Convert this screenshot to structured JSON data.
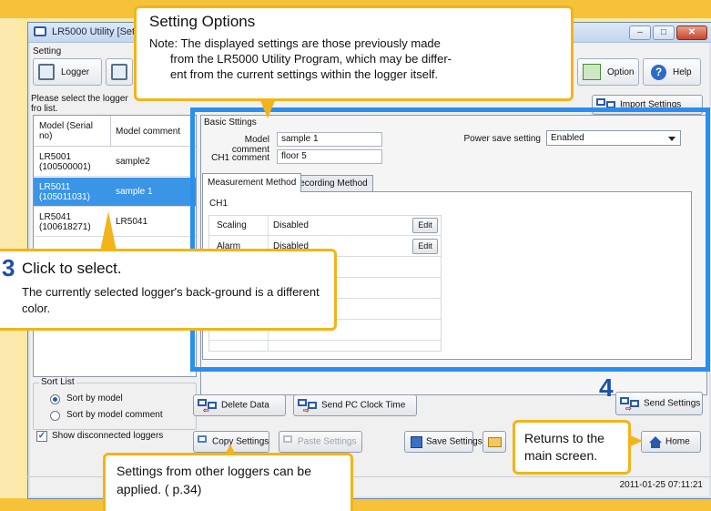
{
  "window": {
    "title": "LR5000 Utility [Setting"
  },
  "toolbar": {
    "setting_group_label": "Setting",
    "logger_label": "Logger",
    "option_label": "Option",
    "help_label": "Help",
    "import_label": "Import Settings"
  },
  "instruction": "Please select the logger fro list.",
  "logger_list": {
    "col_model": "Model (Serial no)",
    "col_comment": "Model comment",
    "rows": [
      {
        "model": "LR5001",
        "serial": "(100500001)",
        "comment": "sample2",
        "selected": false
      },
      {
        "model": "LR5011",
        "serial": "(105011031)",
        "comment": "sample 1",
        "selected": true
      },
      {
        "model": "LR5041",
        "serial": "(100618271)",
        "comment": "LR5041",
        "selected": false
      }
    ]
  },
  "sort": {
    "legend": "Sort List",
    "by_model": "Sort by model",
    "by_comment": "Sort by model comment",
    "selected": "by_model"
  },
  "show_disconnected": {
    "label": "Show disconnected loggers",
    "checked": true
  },
  "basic_settings": {
    "label": "Basic Sttings",
    "model_comment_label": "Model comment",
    "model_comment_value": "sample 1",
    "ch1_comment_label": "CH1 comment",
    "ch1_comment_value": "floor 5",
    "power_save_label": "Power save setting",
    "power_save_value": "Enabled"
  },
  "tabs": [
    {
      "label": "Measurement Method",
      "active": true
    },
    {
      "label": "Recording Method",
      "active": false
    }
  ],
  "channel": {
    "label": "CH1",
    "rows": [
      {
        "key": "Scaling",
        "value": "Disabled",
        "edit": "Edit"
      },
      {
        "key": "Alarm",
        "value": "Disabled",
        "edit": "Edit"
      }
    ]
  },
  "buttons": {
    "delete_data": "Delete Data",
    "send_pc_clock": "Send PC Clock Time",
    "send_settings": "Send Settings",
    "copy_settings": "Copy Settings",
    "paste_settings": "Paste Settings",
    "save_settings": "Save Settings",
    "home": "Home"
  },
  "status": {
    "timestamp": "2011-01-25 07:11:21"
  },
  "callouts": {
    "setting_title": "Setting Options",
    "setting_note_1": "Note: The displayed settings are those previously made",
    "setting_note_2": "from the LR5000 Utility Program, which may be differ-",
    "setting_note_3": "ent from the current settings within the logger itself.",
    "select_number": "3",
    "select_title": "Click to select.",
    "select_desc": "The currently selected logger's back-ground is a different color.",
    "copy_desc": "Settings from other loggers can be applied. ( p.34)",
    "home_desc_1": "Returns to the",
    "home_desc_2": "main screen.",
    "send_number": "4"
  },
  "colors": {
    "highlight_border": "#2a8ef0",
    "callout_border": "#f3b419",
    "selected_row": "#3a95e6",
    "step_number": "#1d4fa8"
  }
}
